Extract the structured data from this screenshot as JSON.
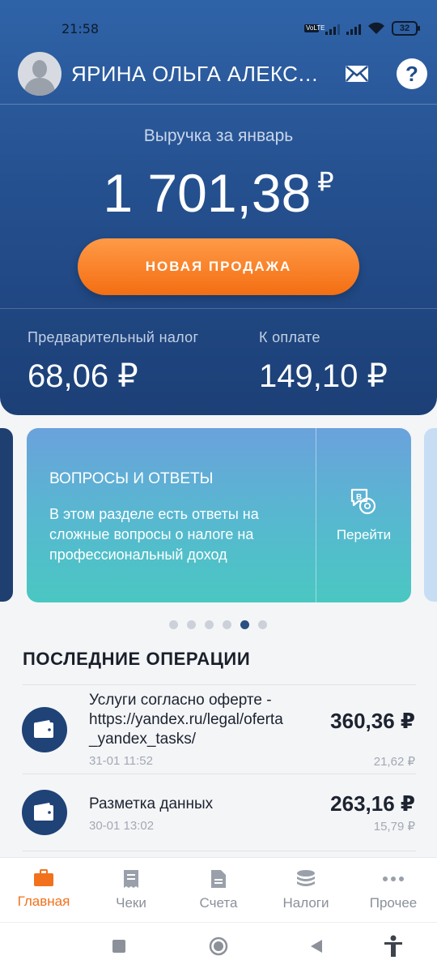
{
  "status_bar": {
    "time": "21:58",
    "network": "VoLTE",
    "battery": "32"
  },
  "header": {
    "user_name": "ЯРИНА ОЛЬГА АЛЕКСАН…",
    "help_label": "?"
  },
  "revenue": {
    "label": "Выручка за январь",
    "amount": "1 701,38",
    "currency": "₽"
  },
  "new_sale_button": "НОВАЯ ПРОДАЖА",
  "taxes": {
    "prelim_label": "Предварительный налог",
    "prelim_value": "68,06 ₽",
    "due_label": "К оплате",
    "due_value": "149,10 ₽"
  },
  "carousel": {
    "card": {
      "title": "ВОПРОСЫ И ОТВЕТЫ",
      "text": "В этом разделе есть ответы на сложные вопросы о налоге на профессиональный доход",
      "action": "Перейти"
    },
    "dots_count": 6,
    "active_dot": 4
  },
  "operations": {
    "title": "ПОСЛЕДНИЕ ОПЕРАЦИИ",
    "items": [
      {
        "description": "Услуги согласно оферте - https://yandex.ru/legal/oferta_yandex_tasks/",
        "desc_lines": [
          "Услуги согласно оферте -",
          "https://yandex.ru/legal/oferta",
          "_yandex_tasks/"
        ],
        "date": "31-01 11:52",
        "amount": "360,36 ₽",
        "tax": "21,62 ₽"
      },
      {
        "description": "Разметка данных",
        "desc_lines": [
          "Разметка данных"
        ],
        "date": "30-01 13:02",
        "amount": "263,16 ₽",
        "tax": "15,79 ₽"
      }
    ]
  },
  "bottom_nav": [
    {
      "label": "Главная",
      "icon": "briefcase-icon",
      "active": true
    },
    {
      "label": "Чеки",
      "icon": "receipt-icon",
      "active": false
    },
    {
      "label": "Счета",
      "icon": "document-icon",
      "active": false
    },
    {
      "label": "Налоги",
      "icon": "coins-icon",
      "active": false
    },
    {
      "label": "Прочее",
      "icon": "more-icon",
      "active": false
    }
  ],
  "colors": {
    "primary_blue": "#25508f",
    "accent_orange": "#f46e12",
    "text_dark": "#1d2330"
  }
}
